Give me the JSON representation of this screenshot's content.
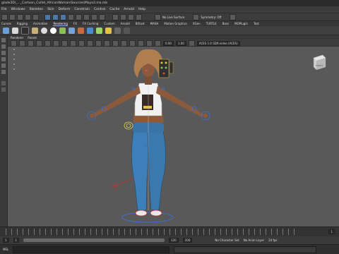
{
  "window": {
    "title": "glade3D\\_..._Cartoon_Cullet_AfricanWoman\\Sources\\Maya3.ma.mb"
  },
  "menu": {
    "items": [
      "File",
      "Windows",
      "Skeleton",
      "Skin",
      "Deform",
      "Constrain",
      "Control",
      "Cache",
      "Arnold",
      "Help"
    ]
  },
  "statusline": {
    "no_live_surface": "No Live Surface",
    "symmetry": "Symmetry: Off"
  },
  "shelf": {
    "tabs": [
      "Curves",
      "Rigging",
      "Animation",
      "Rendering",
      "FX",
      "FX Caching",
      "Custom",
      "Arnold",
      "Bifrost",
      "MASH",
      "Motion Graphics",
      "XGen",
      "TURTLE",
      "Boss",
      "MOPlugin",
      "Test"
    ],
    "active_tab": "Rendering",
    "icon_colors": [
      "#6a9fd8",
      "#d8d8d8",
      "#2e2e2e",
      "#c7b07a",
      "#dcdcdc",
      "#ffffff",
      "#8bbf5a",
      "#7aa2d6",
      "#c96a3a",
      "#4a8cd4",
      "#9ad46a",
      "#e0c34a"
    ]
  },
  "panel": {
    "menus": [
      "Renderer",
      "Panels"
    ]
  },
  "viewtoolbar": {
    "value_a": "0.00",
    "value_b": "1.00",
    "colorspace": "ACES 1.0 SDR-video (ACES)"
  },
  "viewcube": {
    "label": "FRONT"
  },
  "timeline": {
    "start": "1",
    "current": "1",
    "range_start": "1",
    "range_end": "120",
    "end": "200"
  },
  "bottom": {
    "character_set": "No Character Set",
    "anim_layer": "No Anim Layer",
    "fps": "24 fps"
  },
  "cmdline": {
    "mode": "MEL"
  }
}
